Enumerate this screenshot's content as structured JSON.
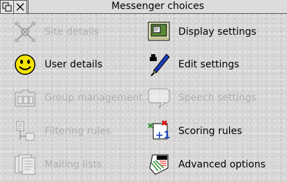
{
  "window": {
    "title": "Messenger choices"
  },
  "items": [
    {
      "label": "Site details",
      "icon": "site-details-icon",
      "enabled": false
    },
    {
      "label": "Display settings",
      "icon": "display-settings-icon",
      "enabled": true
    },
    {
      "label": "User details",
      "icon": "smiley-icon",
      "enabled": true
    },
    {
      "label": "Edit settings",
      "icon": "pen-icon",
      "enabled": true
    },
    {
      "label": "Group management",
      "icon": "folder-icon",
      "enabled": false
    },
    {
      "label": "Speech settings",
      "icon": "speech-bubble-icon",
      "enabled": false
    },
    {
      "label": "Filtering rules",
      "icon": "filter-icon",
      "enabled": false
    },
    {
      "label": "Scoring rules",
      "icon": "scoring-icon",
      "enabled": true
    },
    {
      "label": "Mailing lists",
      "icon": "mailing-list-icon",
      "enabled": false
    },
    {
      "label": "Advanced options",
      "icon": "news-icon",
      "enabled": true
    }
  ]
}
